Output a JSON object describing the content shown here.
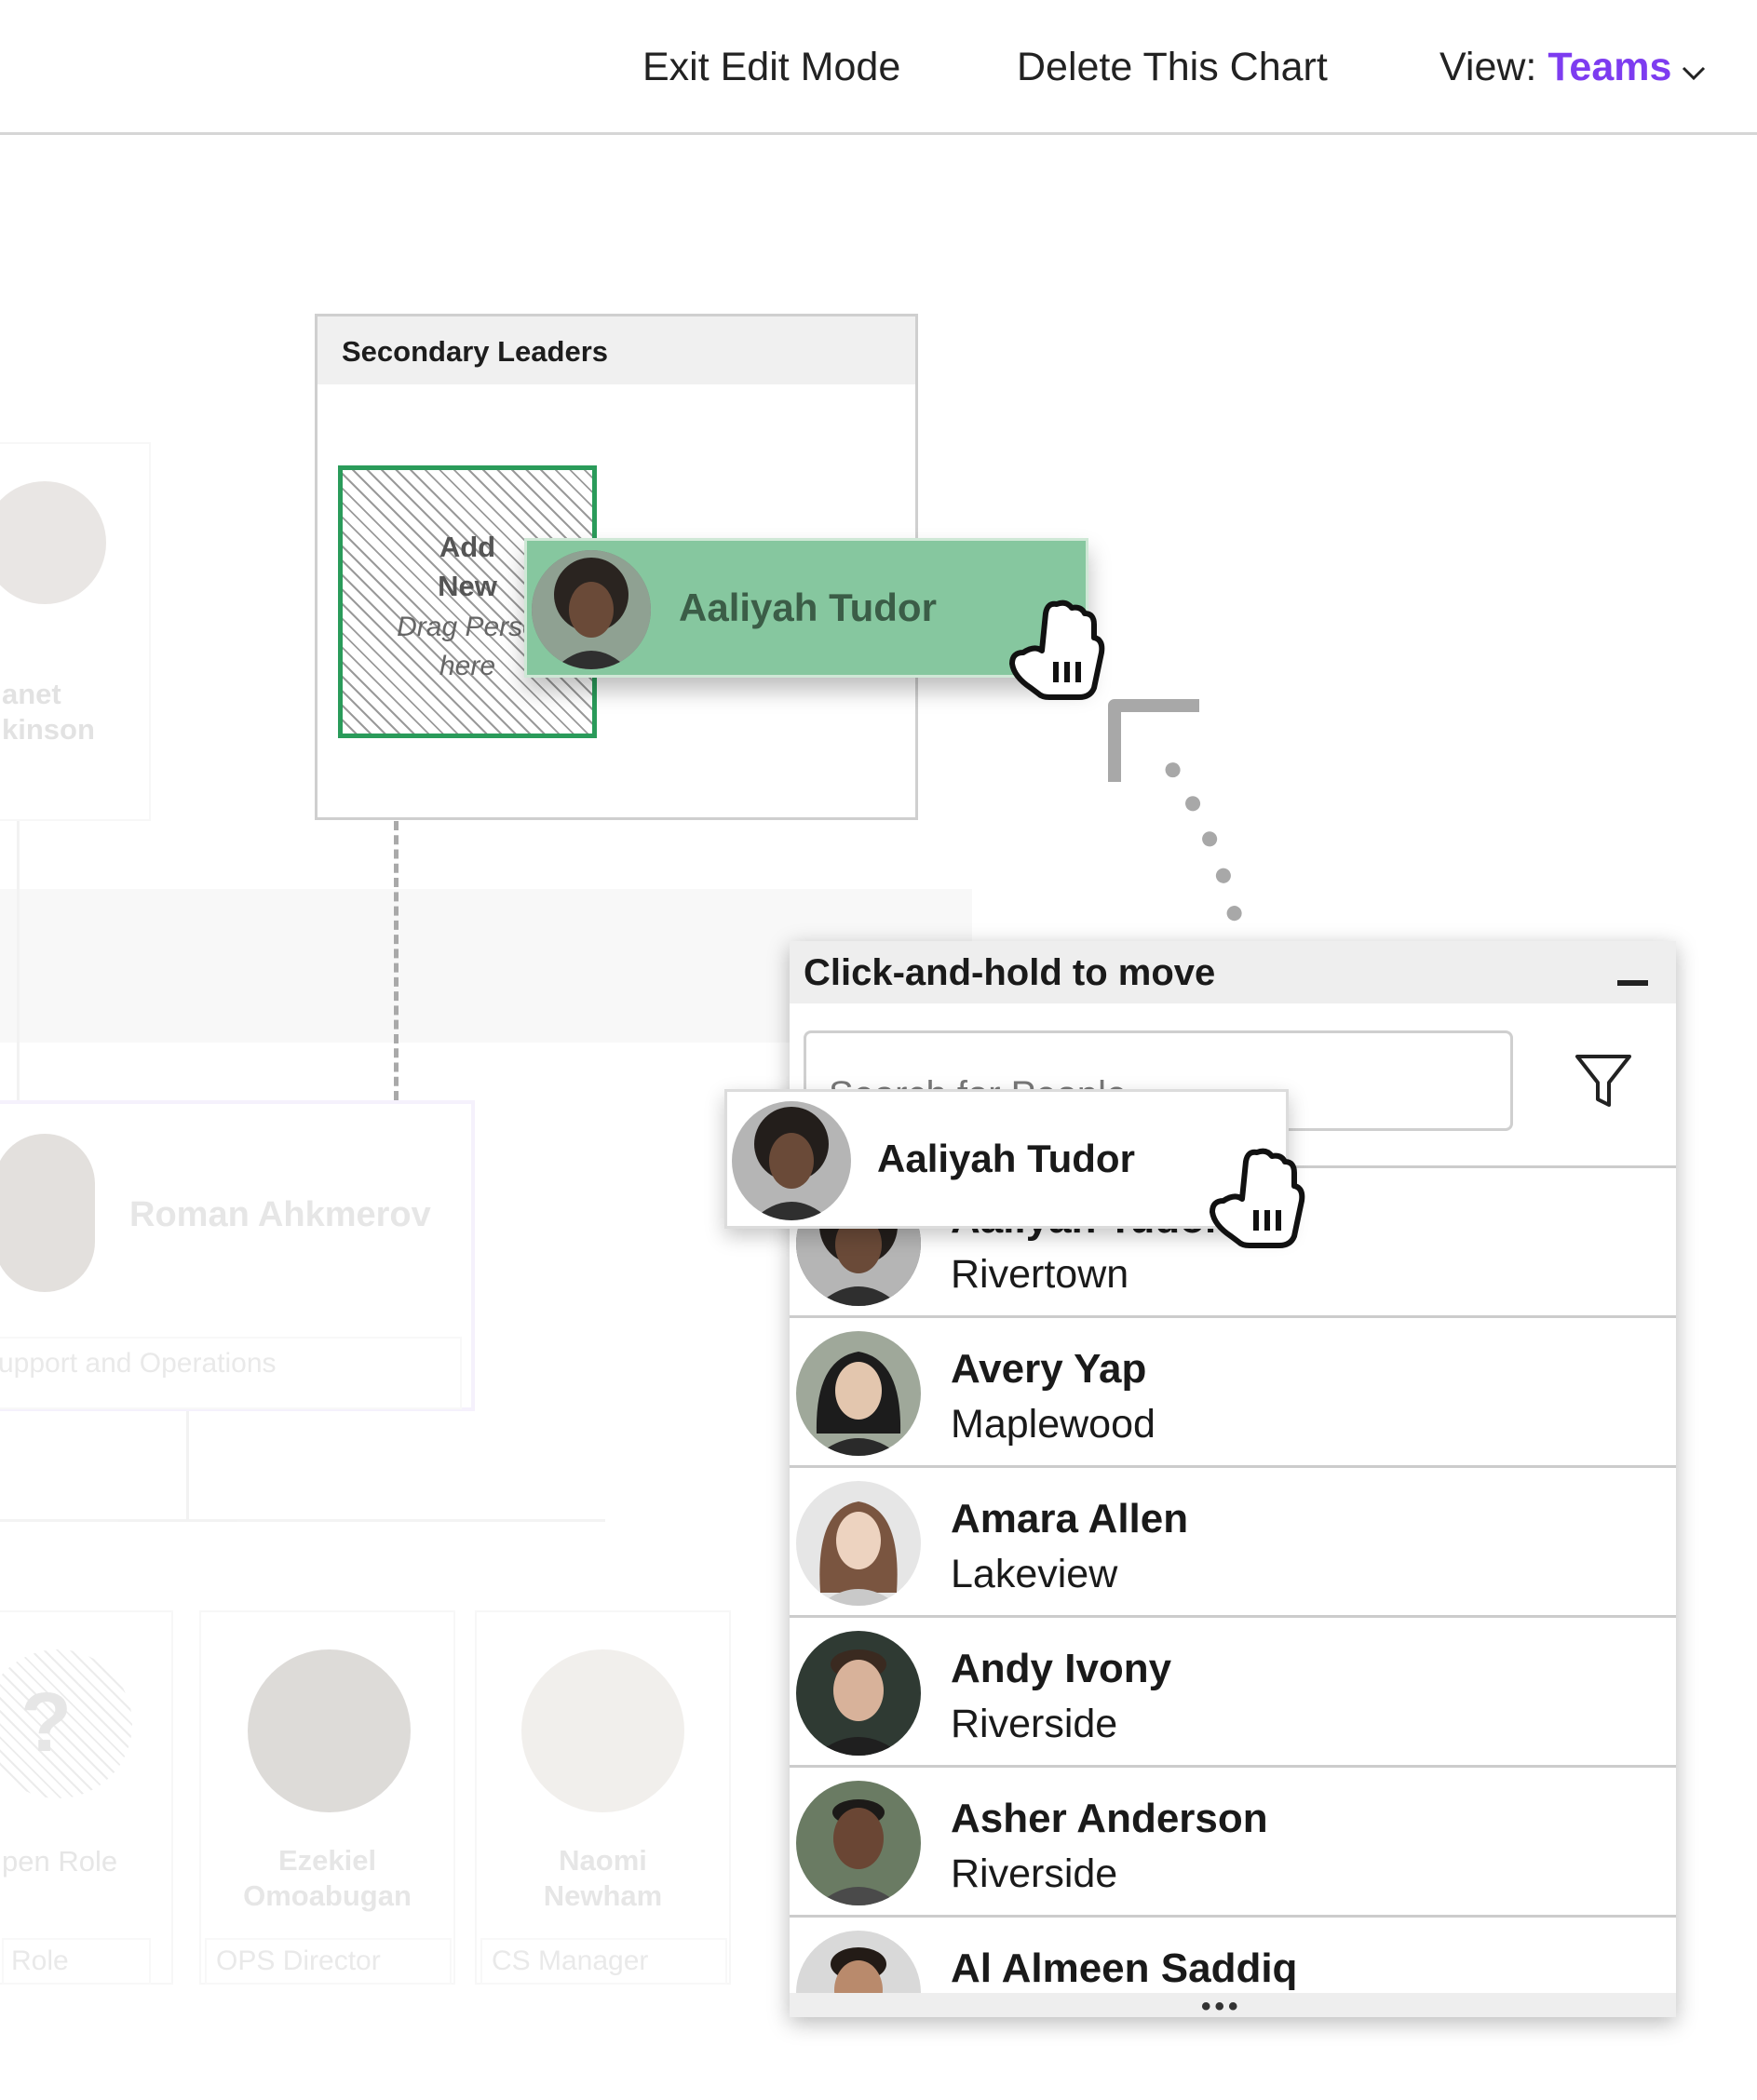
{
  "toolbar": {
    "exit_edit": "Exit Edit Mode",
    "delete_chart": "Delete This Chart",
    "view_label": "View: ",
    "view_value": "Teams"
  },
  "colors": {
    "accent": "#7d3cf0",
    "drop_green": "#86c79f",
    "drop_border": "#2a9b5a"
  },
  "background_chart": {
    "janet": {
      "line1": "anet",
      "line2": "kinson"
    },
    "roman": {
      "name": "Roman Ahkmerov",
      "team": "upport and Operations"
    },
    "open_role": {
      "name": "pen Role",
      "tag": "Role",
      "icon": "?"
    },
    "ezekiel": {
      "line1": "Ezekiel",
      "line2": "Omoabugan",
      "tag": "OPS Director"
    },
    "naomi": {
      "line1": "Naomi",
      "line2": "Newham",
      "tag": "CS Manager"
    }
  },
  "secondary_leaders": {
    "title": "Secondary Leaders",
    "add_new_line1": "Add",
    "add_new_line2": "New",
    "drag_hint_line1": "Drag Perso",
    "drag_hint_line2": "here",
    "dragged_name": "Aaliyah Tudor"
  },
  "panel": {
    "title": "Click-and-hold to move",
    "search_placeholder": "Search for People",
    "dragging_name": "Aaliyah Tudor",
    "people": [
      {
        "name": "Aaliyah Tudor",
        "location": "Rivertown"
      },
      {
        "name": "Avery Yap",
        "location": "Maplewood"
      },
      {
        "name": "Amara Allen",
        "location": "Lakeview"
      },
      {
        "name": "Andy Ivony",
        "location": "Riverside"
      },
      {
        "name": "Asher Anderson",
        "location": "Riverside"
      },
      {
        "name": "Al Almeen Saddiq",
        "location": ""
      }
    ],
    "more": "•••"
  }
}
